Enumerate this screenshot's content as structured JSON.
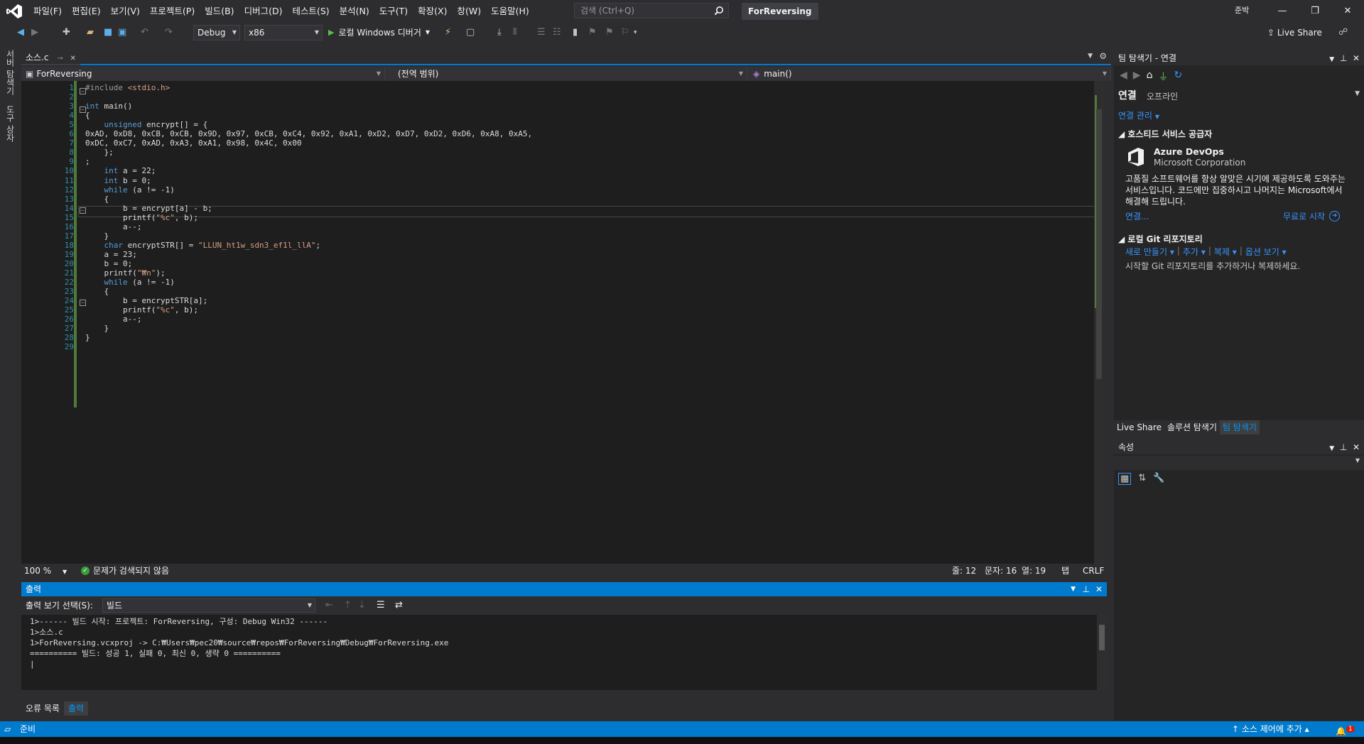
{
  "menu": {
    "items": [
      "파일(F)",
      "편집(E)",
      "보기(V)",
      "프로젝트(P)",
      "빌드(B)",
      "디버그(D)",
      "테스트(S)",
      "분석(N)",
      "도구(T)",
      "확장(X)",
      "창(W)",
      "도움말(H)"
    ],
    "search_placeholder": "검색 (Ctrl+Q)",
    "solution_title": "ForReversing",
    "user_badge": "준박"
  },
  "toolbar": {
    "config": "Debug",
    "platform": "x86",
    "run_label": "로컬 Windows 디버거",
    "live_share": "Live Share"
  },
  "left_tabs": [
    "서버 탐색기",
    "도구 상자"
  ],
  "editor": {
    "tab_name": "소스.c",
    "nav_project": "ForReversing",
    "nav_scope": "(전역 범위)",
    "nav_function": "main()",
    "lines": [
      "#include <stdio.h>",
      "",
      "int main()",
      "{",
      "    unsigned encrypt[] = {",
      "0xAD, 0xD8, 0xCB, 0xCB, 0x9D, 0x97, 0xCB, 0xC4, 0x92, 0xA1, 0xD2, 0xD7, 0xD2, 0xD6, 0xA8, 0xA5,",
      "0xDC, 0xC7, 0xAD, 0xA3, 0xA1, 0x98, 0x4C, 0x00",
      "    };",
      ";",
      "    int a = 22;",
      "    int b = 0;",
      "    while (a != -1)",
      "    {",
      "        b = encrypt[a] - b;",
      "        printf(\"%c\", b);",
      "        a--;",
      "    }",
      "    char encryptSTR[] = \"LLUN_ht1w_sdn3_ef1l_llA\";",
      "    a = 23;",
      "    b = 0;",
      "    printf(\"₩n\");",
      "    while (a != -1)",
      "    {",
      "        b = encryptSTR[a];",
      "        printf(\"%c\", b);",
      "        a--;",
      "    }",
      "}",
      ""
    ],
    "zoom": "100 %",
    "issues": "문제가 검색되지 않음",
    "line_info": "줄: 12",
    "char_info": "문자: 16",
    "col_info": "열: 19",
    "tab_info": "탭",
    "eol_info": "CRLF"
  },
  "output": {
    "title": "출력",
    "source_label": "출력 보기 선택(S):",
    "source_value": "빌드",
    "lines": [
      "1>------ 빌드 시작: 프로젝트: ForReversing, 구성: Debug Win32 ------",
      "1>소스.c",
      "1>ForReversing.vcxproj -> C:₩Users₩pec20₩source₩repos₩ForReversing₩Debug₩ForReversing.exe",
      "========== 빌드: 성공 1, 실패 0, 최신 0, 생략 0 ==========",
      "|"
    ],
    "bottom_tabs": [
      "오류 목록",
      "출력"
    ]
  },
  "team_explorer": {
    "title": "팀 탐색기 - 연결",
    "heading": "연결",
    "heading_sub": "오프라인",
    "manage": "연결 관리",
    "hosted_section": "호스티드 서비스 공급자",
    "azure_name": "Azure DevOps",
    "azure_corp": "Microsoft Corporation",
    "azure_desc": "고품질 소프트웨어를 항상 알맞은 시기에 제공하도록 도와주는 서비스입니다. 코드에만 집중하시고 나머지는 Microsoft에서 해결해 드립니다.",
    "azure_connect": "연결...",
    "azure_free": "무료로 시작",
    "git_section": "로컬 Git 리포지토리",
    "git_actions": [
      "새로 만들기",
      "추가",
      "복제",
      "옵션 보기"
    ],
    "git_desc": "시작할 Git 리포지토리를 추가하거나 복제하세요.",
    "tabs": [
      "Live Share",
      "솔루션 탐색기",
      "팀 탐색기"
    ]
  },
  "properties": {
    "title": "속성"
  },
  "statusbar": {
    "ready": "준비",
    "source_control": "소스 제어에 추가",
    "notify_count": "1"
  },
  "colors": {
    "accent": "#007acc",
    "editor_bg": "#1e1e1e",
    "keyword": "#569cd6",
    "line_number": "#2b91af",
    "link": "#3794ff"
  }
}
